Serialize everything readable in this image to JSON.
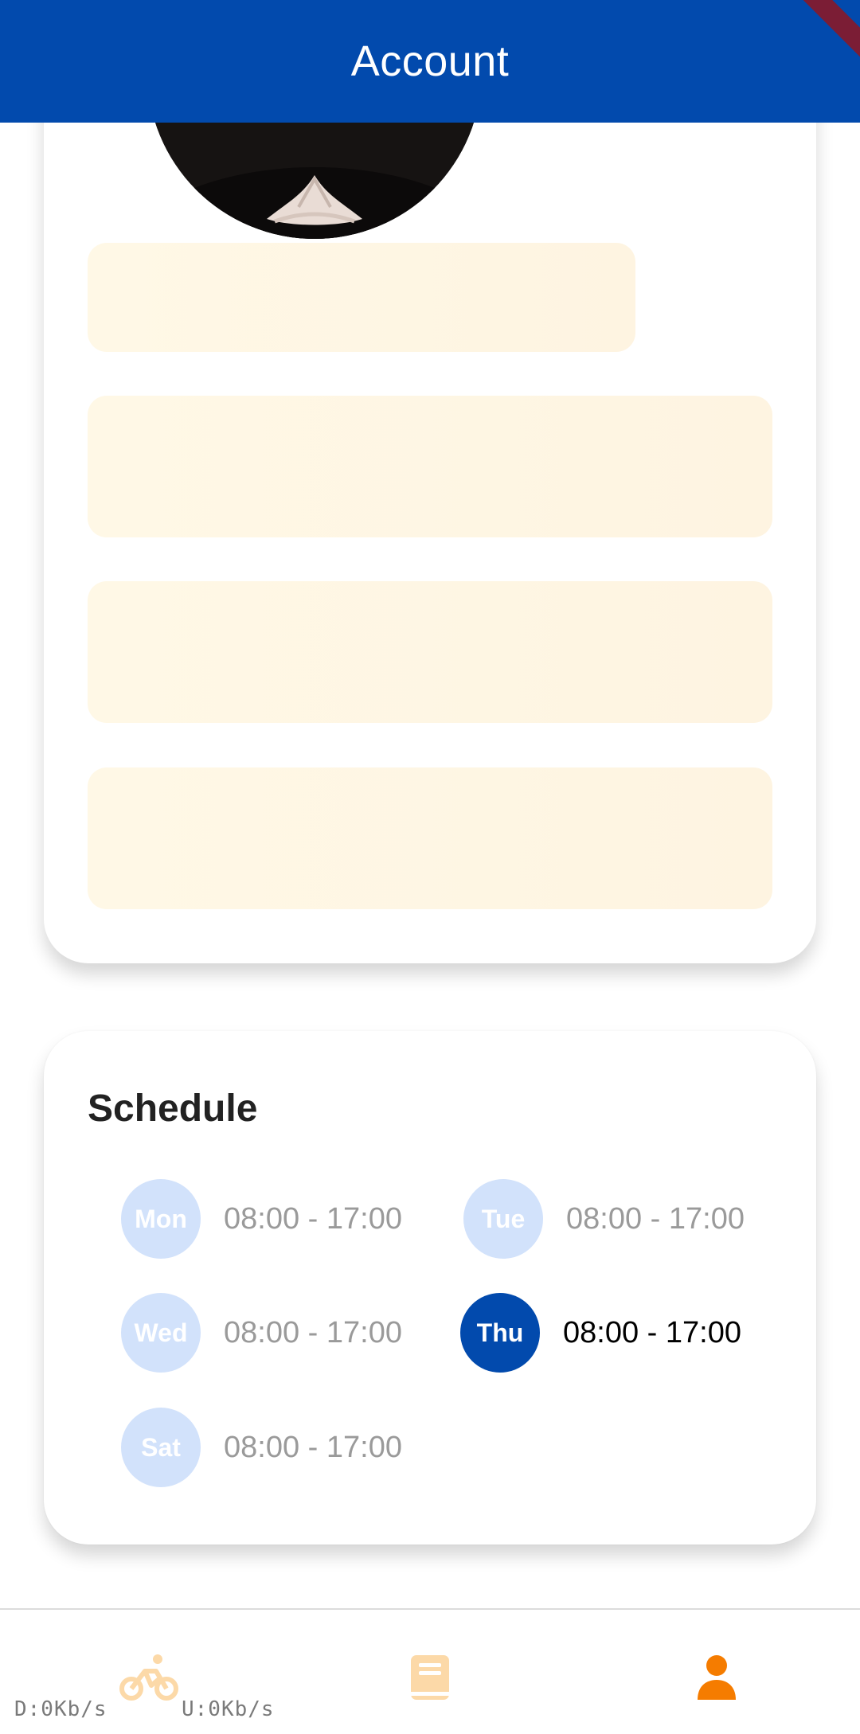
{
  "appbar": {
    "title": "Account"
  },
  "schedule": {
    "title": "Schedule",
    "days": [
      {
        "day": "Mon",
        "time": "08:00 - 17:00",
        "active": false
      },
      {
        "day": "Tue",
        "time": "08:00 - 17:00",
        "active": false
      },
      {
        "day": "Wed",
        "time": "08:00 - 17:00",
        "active": false
      },
      {
        "day": "Thu",
        "time": "08:00 - 17:00",
        "active": true
      },
      {
        "day": "Sat",
        "time": "08:00 - 17:00",
        "active": false
      }
    ]
  },
  "nav": {
    "items": [
      {
        "icon": "bike-icon",
        "active": false
      },
      {
        "icon": "book-icon",
        "active": false
      },
      {
        "icon": "person-icon",
        "active": true
      }
    ],
    "download": "D:0Kb/s",
    "upload": "U:0Kb/s"
  },
  "colors": {
    "primary": "#024aad",
    "day_inactive": "#d2e2fb",
    "nav_active": "#f57c00",
    "nav_inactive": "#fcd9a8",
    "skeleton": "#fff8e6"
  }
}
